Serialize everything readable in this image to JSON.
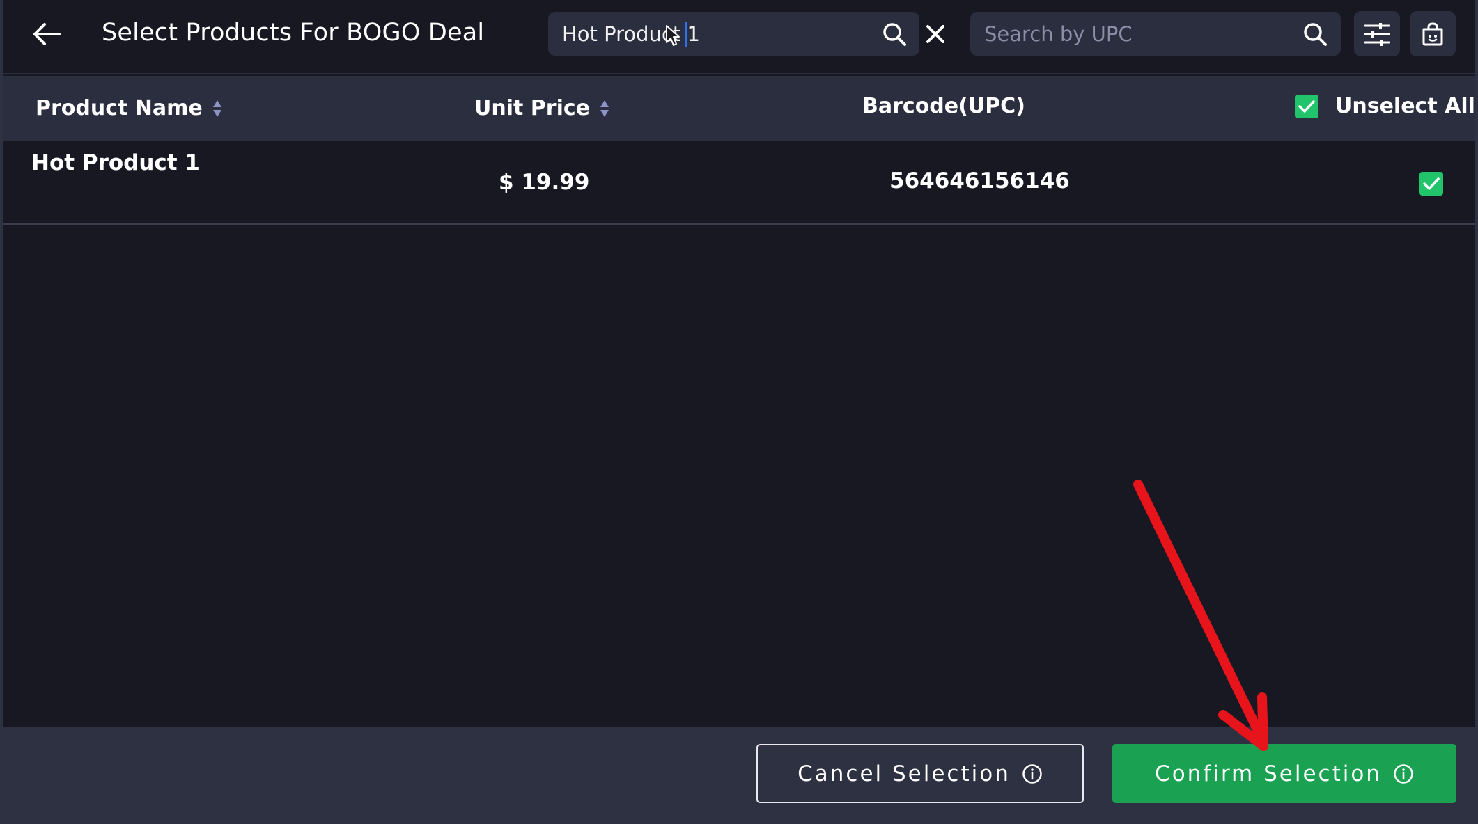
{
  "header": {
    "title": "Select Products For BOGO Deal",
    "search_name_value": "Hot Product 1",
    "search_upc_placeholder": "Search by UPC",
    "back_icon": "arrow-left-icon",
    "search_icon": "magnifier-icon",
    "clear_icon": "close-icon",
    "filter_icon": "sliders-icon",
    "store_icon": "store-bag-icon"
  },
  "table": {
    "columns": {
      "product_name": "Product Name",
      "unit_price": "Unit Price",
      "barcode": "Barcode(UPC)",
      "select_all": "Unselect All"
    },
    "select_all_checked": true,
    "rows": [
      {
        "name": "Hot Product 1",
        "price": "$ 19.99",
        "barcode": "564646156146",
        "checked": true
      }
    ]
  },
  "footer": {
    "cancel_label": "Cancel Selection",
    "confirm_label": "Confirm Selection"
  },
  "colors": {
    "background": "#181823",
    "header_row": "#2b2e3f",
    "footer": "#2e3142",
    "accent_green": "#1aa152",
    "checkbox_green": "#21c36b",
    "annotation_red": "#e8141c"
  }
}
